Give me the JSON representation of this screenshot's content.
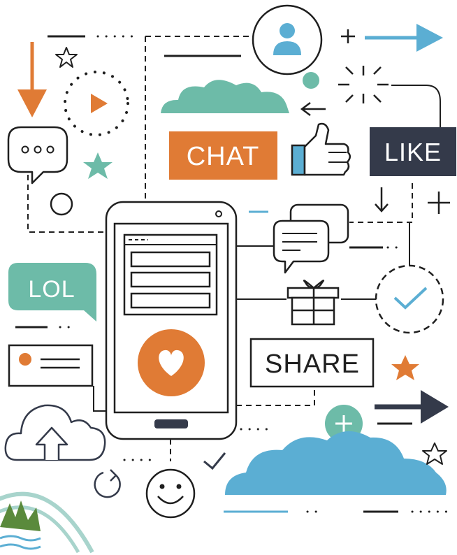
{
  "labels": {
    "chat": "CHAT",
    "like": "LIKE",
    "lol": "LOL",
    "share": "SHARE"
  },
  "colors": {
    "orange": "#e07b35",
    "teal": "#6dbba8",
    "blue": "#5baed3",
    "navy": "#343a4a",
    "ink": "#1f1f1f"
  },
  "icons": [
    "user-icon",
    "star-icon",
    "play-icon",
    "ellipsis-bubble-icon",
    "thumbs-up-icon",
    "heart-icon",
    "gift-icon",
    "checkmark-icon",
    "plus-icon",
    "upload-cloud-icon",
    "refresh-icon",
    "smiley-icon",
    "arrow-right-icon",
    "arrow-down-icon",
    "arrow-left-icon",
    "sparkle-icon",
    "message-bubbles-icon",
    "cloud-icon",
    "logo-mark"
  ]
}
